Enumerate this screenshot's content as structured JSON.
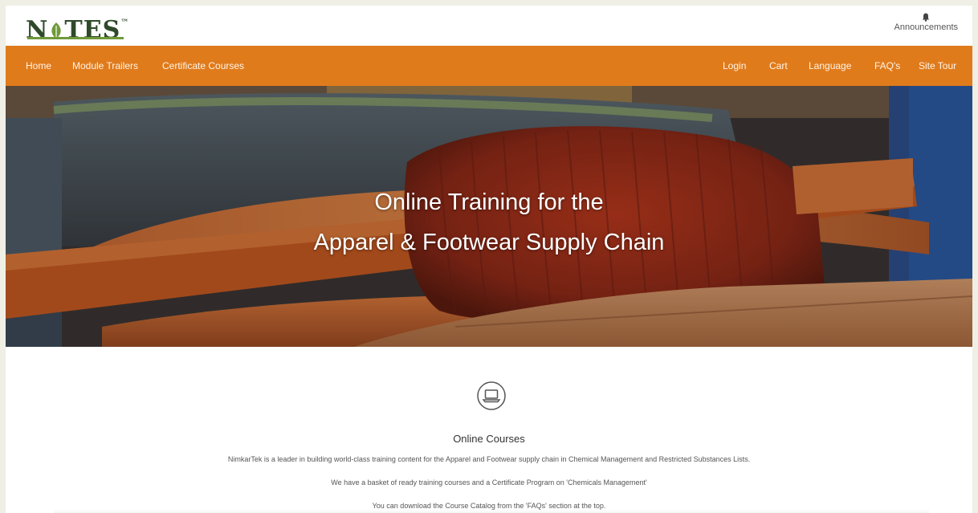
{
  "header": {
    "logo_text": "NOTES",
    "logo_tm": "™",
    "announcements_label": "Announcements"
  },
  "nav": {
    "left": [
      "Home",
      "Module Trailers",
      "Certificate Courses"
    ],
    "right": [
      "Login",
      "Cart",
      "Language",
      "FAQ's",
      "Site Tour"
    ]
  },
  "hero": {
    "line1": "Online Training for the",
    "line2": "Apparel & Footwear Supply Chain"
  },
  "courses": {
    "title": "Online Courses",
    "paragraphs": [
      "NimkarTek is a leader in building world-class training content for the Apparel and Footwear supply chain in Chemical Management and Restricted Substances Lists.",
      "We have a basket of ready training courses and a Certificate Program on 'Chemicals Management'",
      "You can download the Course Catalog from the 'FAQs' section at the top."
    ]
  },
  "colors": {
    "nav_bg": "#e07b1c",
    "logo_green": "#2f4a2a",
    "leaf_green": "#6f9a3a"
  },
  "icons": [
    "leaf-icon",
    "bell-icon",
    "laptop-icon"
  ]
}
